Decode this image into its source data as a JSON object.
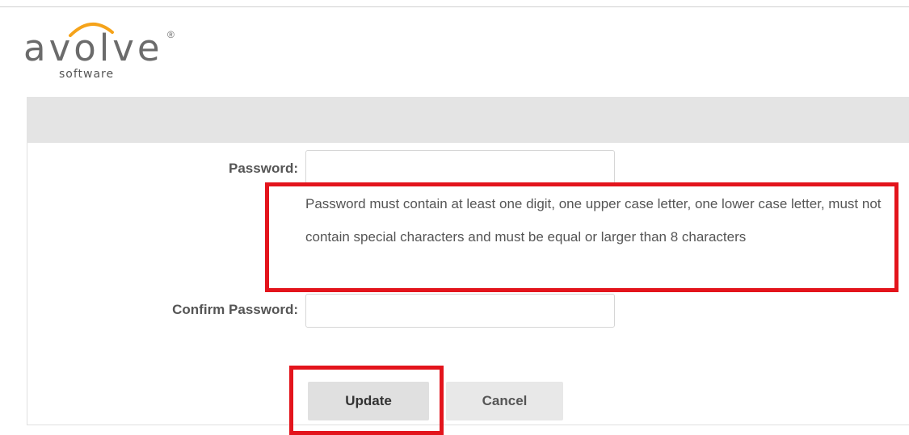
{
  "brand": {
    "logo_text": "avolve",
    "logo_subtext": "software",
    "registered_mark": "®"
  },
  "form": {
    "password_label": "Password:",
    "password_value": "",
    "password_hint": "Password must contain at least one digit, one upper case letter, one lower case letter, must not contain special characters and must be equal or larger than 8 characters",
    "confirm_label": "Confirm Password:",
    "confirm_value": ""
  },
  "buttons": {
    "update_label": "Update",
    "cancel_label": "Cancel"
  },
  "colors": {
    "highlight": "#e3141c",
    "header_bar": "#e4e4e4",
    "logo_accent": "#f5a31a"
  }
}
